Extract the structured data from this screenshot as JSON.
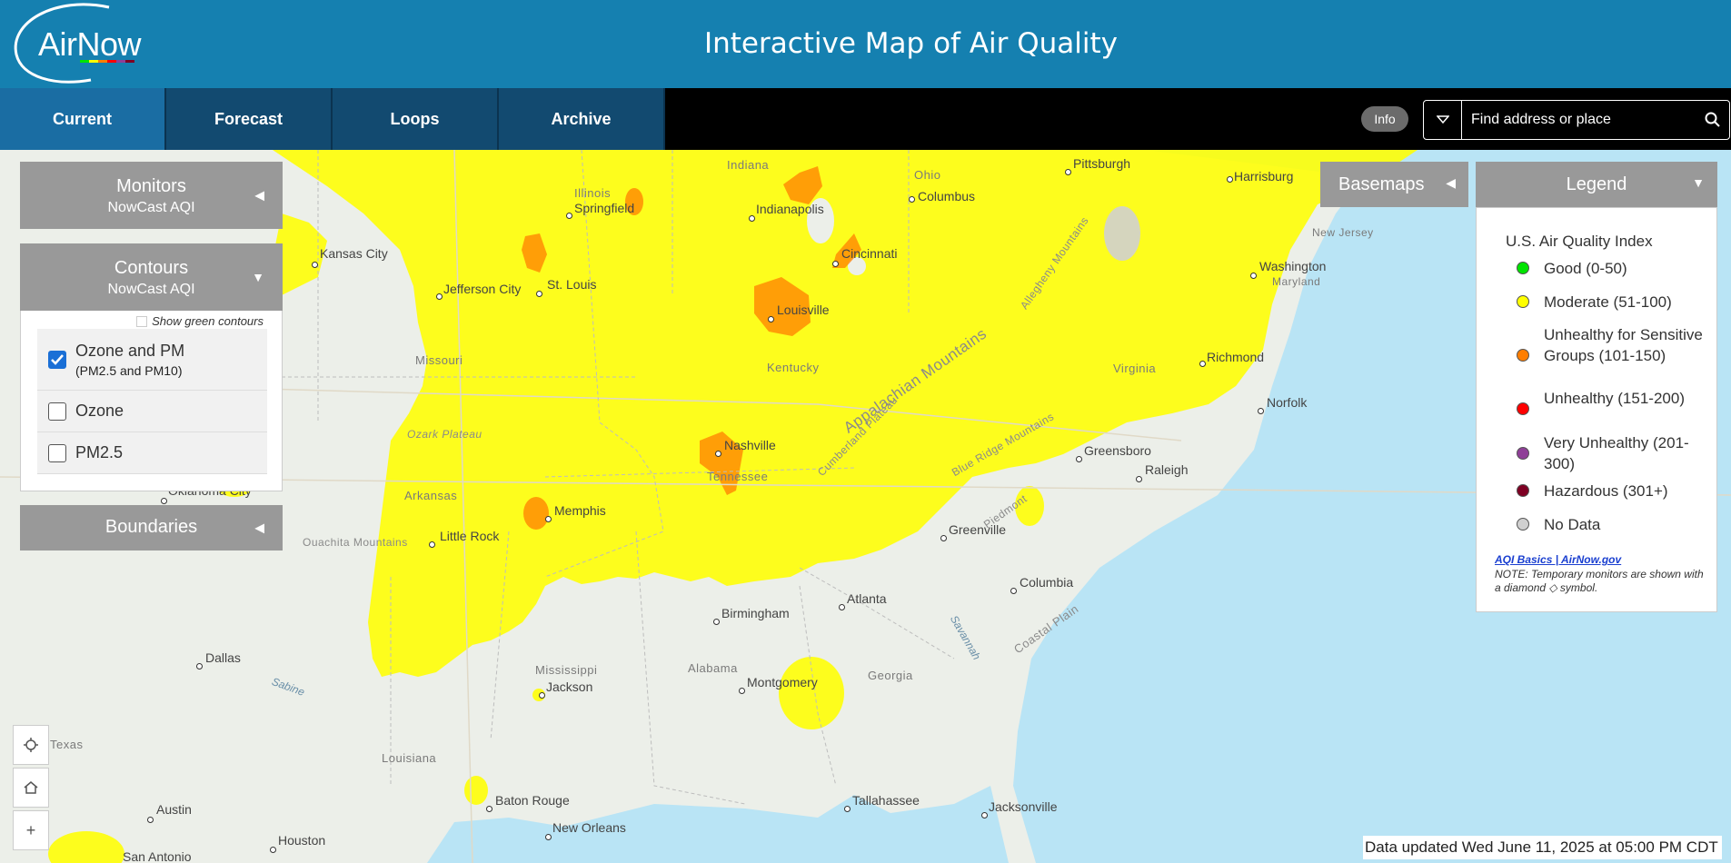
{
  "header": {
    "logo_text": "AirNow",
    "title": "Interactive Map of Air Quality"
  },
  "nav": {
    "tabs": [
      {
        "label": "Current",
        "active": true
      },
      {
        "label": "Forecast"
      },
      {
        "label": "Loops"
      },
      {
        "label": "Archive"
      }
    ],
    "info_label": "Info",
    "search_placeholder": "Find address or place"
  },
  "monitors_panel": {
    "title": "Monitors",
    "subtitle": "NowCast AQI"
  },
  "contours_panel": {
    "title": "Contours",
    "subtitle": "NowCast AQI",
    "show_green_label": "Show green contours",
    "options": [
      {
        "label": "Ozone and PM",
        "sublabel": "(PM2.5 and PM10)",
        "checked": true
      },
      {
        "label": "Ozone",
        "checked": false
      },
      {
        "label": "PM2.5",
        "checked": false
      }
    ]
  },
  "boundaries_panel": {
    "title": "Boundaries"
  },
  "basemaps": {
    "title": "Basemaps"
  },
  "legend": {
    "header": "Legend",
    "title": "U.S. Air Quality Index",
    "items": [
      {
        "label": "Good (0-50)",
        "color": "#00e400"
      },
      {
        "label": "Moderate (51-100)",
        "color": "#ffff00"
      },
      {
        "label": "Unhealthy for Sensitive Groups (101-150)",
        "color": "#ff7e00"
      },
      {
        "label": "Unhealthy (151-200)",
        "color": "#ff0000"
      },
      {
        "label": "Very Unhealthy (201-300)",
        "color": "#8f3f97"
      },
      {
        "label": "Hazardous (301+)",
        "color": "#7e0023"
      },
      {
        "label": "No Data",
        "color": "#d0d0d0"
      }
    ],
    "link": "AQI Basics | AirNow.gov",
    "note": "NOTE: Temporary monitors are shown with a diamond ◇ symbol."
  },
  "map": {
    "cities": [
      "Pittsburgh",
      "Harrisburg",
      "Columbus",
      "Indianapolis",
      "Springfield",
      "Kansas City",
      "Cincinnati",
      "Washington",
      "St. Louis",
      "Jefferson City",
      "Louisville",
      "Richmond",
      "Norfolk",
      "Nashville",
      "Greensboro",
      "Raleigh",
      "Memphis",
      "Little Rock",
      "Greenville",
      "Columbia",
      "Atlanta",
      "Birmingham",
      "Dallas",
      "Jackson",
      "Montgomery",
      "Austin",
      "Baton Rouge",
      "New Orleans",
      "Tallahassee",
      "Jacksonville",
      "Houston",
      "San Antonio",
      "Oklahoma City"
    ],
    "states": [
      "Indiana",
      "Ohio",
      "Illinois",
      "Missouri",
      "Kentucky",
      "Virginia",
      "Tennessee",
      "Arkansas",
      "Mississippi",
      "Alabama",
      "Georgia",
      "Louisiana",
      "Texas",
      "New Jersey",
      "Maryland"
    ],
    "regions": [
      "Appalachian Mountains",
      "Allegheny Mountains",
      "Blue Ridge Mountains",
      "Cumberland Plateau",
      "Piedmont",
      "Coastal Plain",
      "Ozark Plateau",
      "Ouachita Mountains"
    ],
    "water": [
      "Sabine",
      "Savannah"
    ]
  },
  "map_controls": {
    "locate_icon": "locate-icon",
    "home_icon": "home-icon",
    "zoom_in": "+"
  },
  "status": {
    "data_updated": "Data updated Wed June 11, 2025 at 05:00 PM CDT"
  }
}
